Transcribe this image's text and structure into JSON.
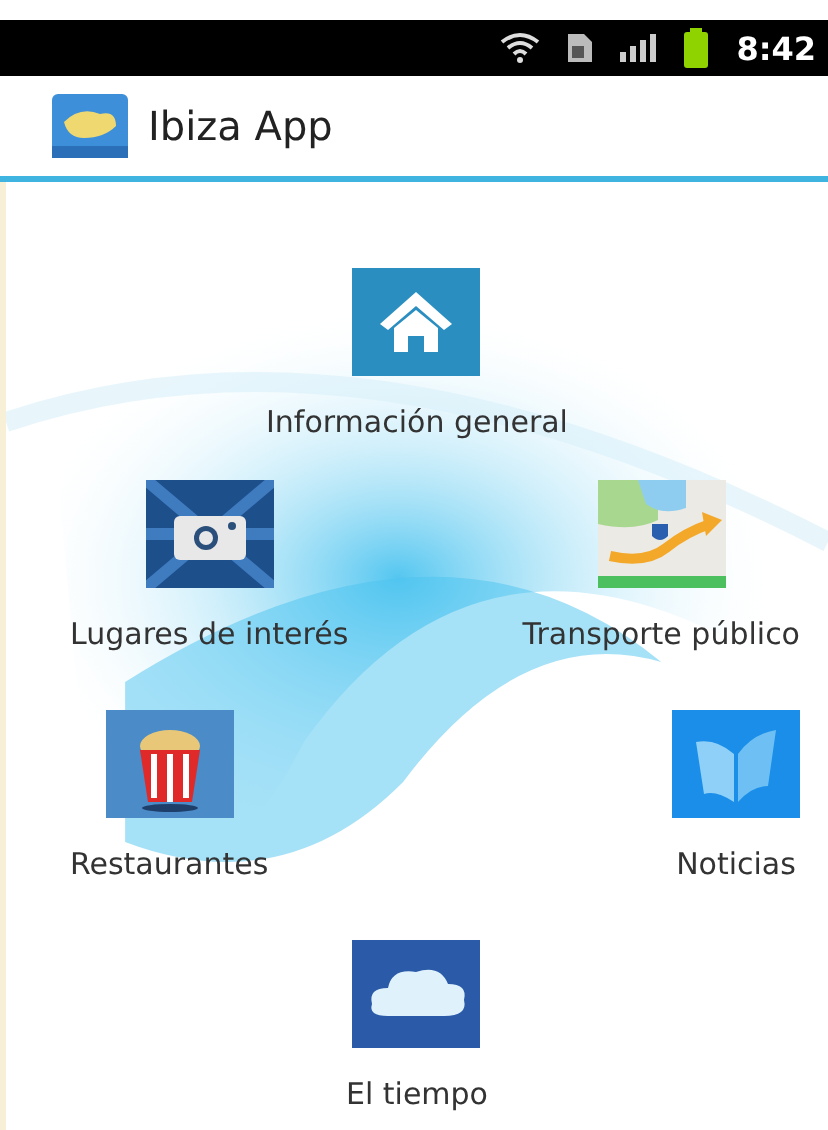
{
  "status_bar": {
    "time": "8:42"
  },
  "app_bar": {
    "title": "Ibiza App"
  },
  "menu_rows": [
    [
      {
        "label": "Información general",
        "kind": "home"
      }
    ],
    [
      {
        "label": "Lugares de interés",
        "kind": "camera"
      },
      {
        "label": "Transporte público",
        "kind": "map"
      }
    ],
    [
      {
        "label": "Restaurantes",
        "kind": "popcorn"
      },
      {
        "label": "Noticias",
        "kind": "book"
      }
    ],
    [
      {
        "label": "El tiempo",
        "kind": "cloud"
      }
    ]
  ]
}
